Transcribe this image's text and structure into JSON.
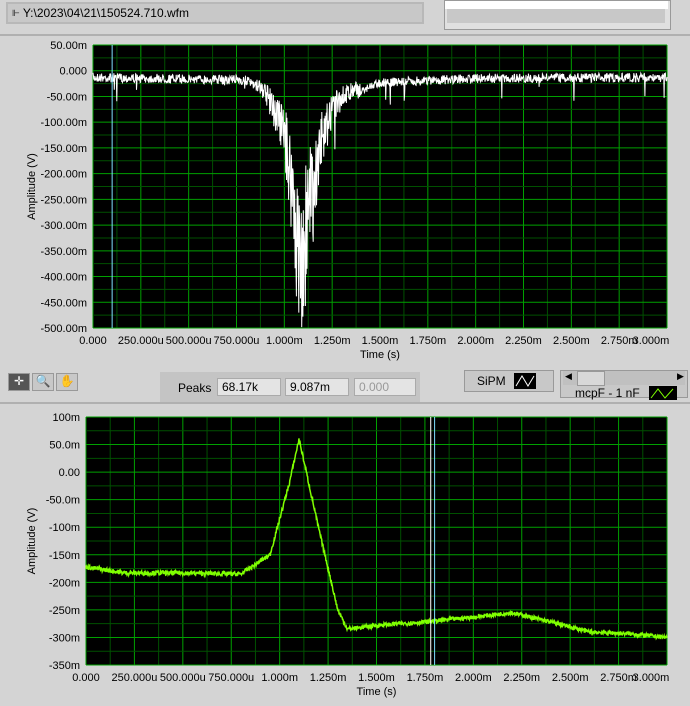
{
  "file_path": "Y:\\2023\\04\\21\\150524.710.wfm",
  "peaks": {
    "label": "Peaks",
    "values": [
      "68.17k",
      "9.087m",
      "0.000"
    ]
  },
  "legend": {
    "sipm": "SiPM",
    "mcpf": "mcpF - 1 nF"
  },
  "colors": {
    "top_trace": "#ffffff",
    "bottom_trace": "#7fff00",
    "grid_major": "#00a000",
    "grid_minor": "#005000",
    "plot_bg": "#000000",
    "cursor": "#80e0ff"
  },
  "chart_data": [
    {
      "type": "line",
      "xlabel": "Time (s)",
      "ylabel": "Amplitude (V)",
      "xlim": [
        0,
        0.003
      ],
      "ylim": [
        -0.5,
        0.05
      ],
      "x_ticks": [
        "0.000",
        "250.000u",
        "500.000u",
        "750.000u",
        "1.000m",
        "1.250m",
        "1.500m",
        "1.750m",
        "2.000m",
        "2.250m",
        "2.500m",
        "2.750m",
        "3.000m"
      ],
      "y_ticks": [
        "50.00m",
        "0.000",
        "-50.00m",
        "-100.00m",
        "-150.00m",
        "-200.00m",
        "-250.00m",
        "-300.00m",
        "-350.00m",
        "-400.00m",
        "-450.00m",
        "-500.00m"
      ],
      "series": [
        {
          "name": "SiPM",
          "x_ms": [
            0,
            0.8,
            0.9,
            1.0,
            1.05,
            1.08,
            1.12,
            1.2,
            1.3,
            1.5,
            2.0,
            3.0
          ],
          "y": [
            -0.01,
            -0.015,
            -0.04,
            -0.12,
            -0.25,
            -0.4,
            -0.3,
            -0.12,
            -0.05,
            -0.02,
            -0.012,
            -0.01
          ]
        }
      ],
      "cursor_x_ms": 0.1
    },
    {
      "type": "line",
      "xlabel": "Time (s)",
      "ylabel": "Amplitude (V)",
      "xlim": [
        0,
        0.003
      ],
      "ylim": [
        -0.35,
        0.1
      ],
      "x_ticks": [
        "0.000",
        "250.000u",
        "500.000u",
        "750.000u",
        "1.000m",
        "1.250m",
        "1.500m",
        "1.750m",
        "2.000m",
        "2.250m",
        "2.500m",
        "2.750m",
        "3.000m"
      ],
      "y_ticks": [
        "100m",
        "50.0m",
        "0.00",
        "-50.0m",
        "-100m",
        "-150m",
        "-200m",
        "-250m",
        "-300m",
        "-350m"
      ],
      "series": [
        {
          "name": "mcpF - 1 nF",
          "x_ms": [
            0,
            0.2,
            0.5,
            0.8,
            0.95,
            1.05,
            1.1,
            1.2,
            1.3,
            1.35,
            1.5,
            1.75,
            2.0,
            2.2,
            2.4,
            2.6,
            2.8,
            3.0
          ],
          "y": [
            -0.172,
            -0.183,
            -0.183,
            -0.185,
            -0.15,
            -0.02,
            0.06,
            -0.1,
            -0.25,
            -0.285,
            -0.278,
            -0.272,
            -0.263,
            -0.255,
            -0.272,
            -0.29,
            -0.293,
            -0.3
          ]
        }
      ],
      "cursor_x_ms": [
        1.78,
        1.8
      ]
    }
  ]
}
